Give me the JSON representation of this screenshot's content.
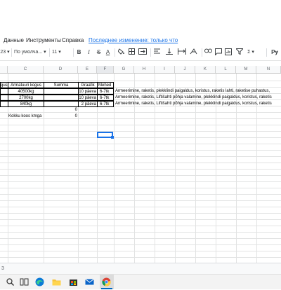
{
  "menu": {
    "items": [
      "Данные",
      "Инструменты",
      "Справка"
    ],
    "last_edit": "Последнее изменение: только что"
  },
  "toolbar": {
    "zoom_partial": "23",
    "font": "По умолча...",
    "font_size": "11",
    "bold": "B",
    "italic": "I",
    "strikethrough": "S",
    "text_color": "A",
    "sum": "Σ",
    "input_tools": "Рɏ"
  },
  "columns": [
    "",
    "C",
    "D",
    "E",
    "F",
    "G",
    "H",
    "I",
    "J",
    "K",
    "L",
    "M",
    "N"
  ],
  "selected_column": "F",
  "headers": {
    "b": "gus",
    "c": "Armatuuri kogus",
    "d": "Summa",
    "e": "Graafik",
    "f": "Mehed"
  },
  "rows": [
    {
      "c": "40500kg",
      "e": "10 päeva",
      "f": "6-7tk",
      "g": "Armeerimine, raketis, plekklindi paigaldus, koristus, raketis lahti, raketise puhastus,"
    },
    {
      "c": "2700kg",
      "e": "10 päeva",
      "f": "6-7tk",
      "g": "Armeerimine, raketis, Liftišahti põhja valamine, plekklindi paigaldus, koristus, raketis"
    },
    {
      "c": "840kg",
      "e": "2 päeva",
      "f": "6-7tk",
      "g": "Armeerimine, raketis, Liftišahti põhja valamine, plekklindi paigaldus, koristus, raketis"
    }
  ],
  "summa_value": "0",
  "total": {
    "label": "Kokku koos kmga",
    "value": "0"
  },
  "sheet_tab": "3",
  "accent_color": "#1a73e8"
}
